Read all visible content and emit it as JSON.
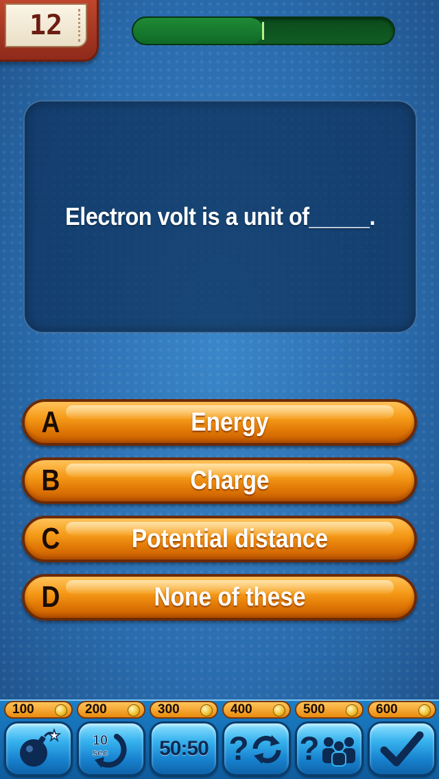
{
  "header": {
    "question_number": "12",
    "timer_progress": 0.5
  },
  "question": {
    "text": "Electron volt is a unit of_____."
  },
  "answers": [
    {
      "letter": "A",
      "text": "Energy"
    },
    {
      "letter": "B",
      "text": "Charge"
    },
    {
      "letter": "C",
      "text": "Potential distance"
    },
    {
      "letter": "D",
      "text": "None of these"
    }
  ],
  "lifelines": [
    {
      "cost": "100",
      "icon": "bomb-icon"
    },
    {
      "cost": "200",
      "icon": "add-10-seconds-icon",
      "label_top": "10",
      "label_bottom": "sec"
    },
    {
      "cost": "300",
      "icon": "fifty-fifty-icon",
      "label": "50:50"
    },
    {
      "cost": "400",
      "icon": "swap-question-icon"
    },
    {
      "cost": "500",
      "icon": "ask-audience-icon"
    },
    {
      "cost": "600",
      "icon": "checkmark-icon"
    }
  ],
  "colors": {
    "background": "#2a6cae",
    "answer_orange": "#f59a18",
    "lifeline_blue": "#37b2ee",
    "progress_green": "#1f8a36"
  }
}
